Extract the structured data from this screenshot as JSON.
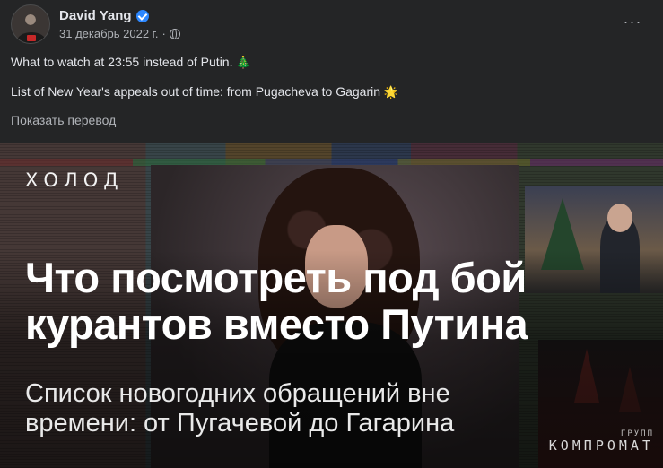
{
  "post": {
    "author": "David Yang",
    "date": "31 декабрь 2022 г.",
    "separator": "·",
    "more_label": "···",
    "text_line1": "What to watch at 23:55 instead of Putin.",
    "text_line1_emoji": "🎄",
    "text_line2": "List of New Year's appeals out of time: from Pugacheva to Gagarin",
    "text_line2_emoji": "🌟",
    "translate_label": "Показать перевод"
  },
  "media": {
    "brand": "ХОЛОД",
    "headline_line1": "Что посмотреть под бой",
    "headline_line2": "курантов вместо Путина",
    "subline_line1": "Список новогодних обращений вне",
    "subline_line2": "времени: от Пугачевой до Гагарина",
    "watermark_small": "ГРУПП",
    "watermark_big": "КОМПРОМАТ"
  },
  "colors": {
    "background": "#242526",
    "text_primary": "#e4e6eb",
    "text_secondary": "#b0b3b8",
    "verified": "#2d88ff"
  },
  "icons": [
    "verified-badge-icon",
    "globe-icon",
    "more-options-icon",
    "christmas-tree-emoji",
    "star-emoji"
  ]
}
